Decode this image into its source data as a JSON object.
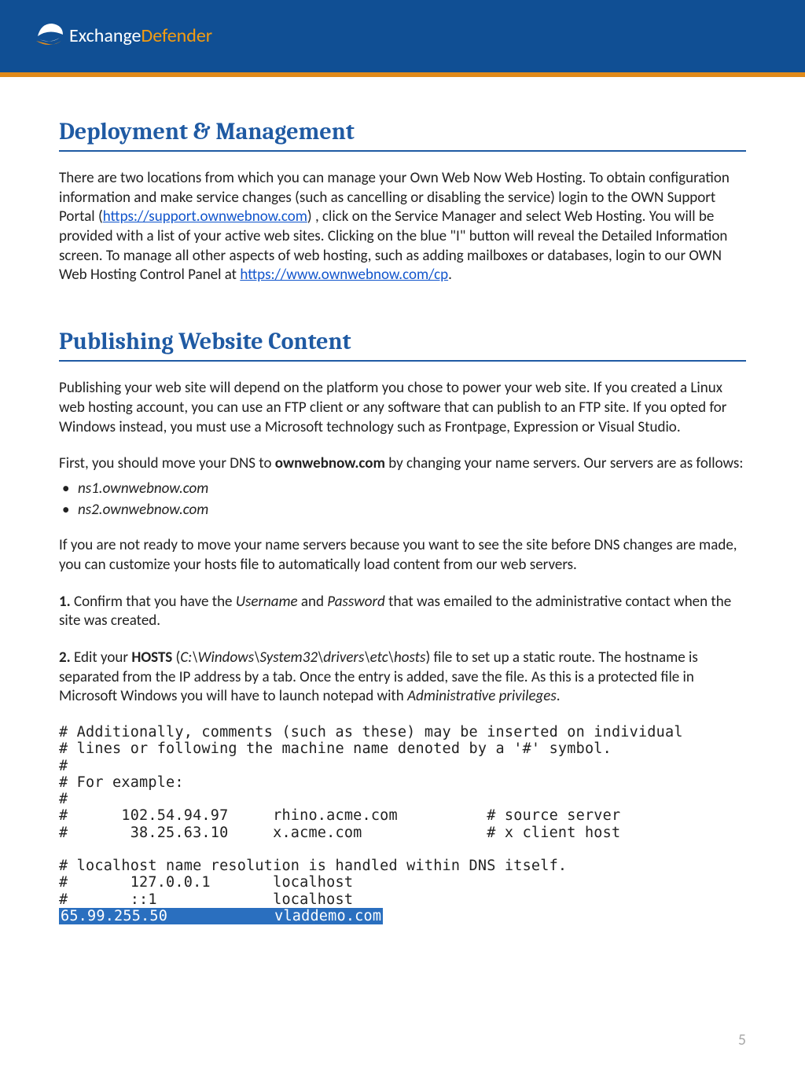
{
  "logo": {
    "part1": "Exchange",
    "part2": "Defender"
  },
  "h1a": "Deployment & Management",
  "p1a": "There are two locations from which you can manage your Own Web Now Web Hosting. To obtain configuration information and make service changes (such as cancelling or disabling the service) login to the OWN Support Portal (",
  "p1link": "https://support.ownwebnow.com",
  "p1b": ") , click on the Service Manager and select Web Hosting. You will be provided with a list of your active web sites. Clicking on the blue \"I\" button will reveal the Detailed Information screen. To manage all other aspects of web hosting, such as adding mailboxes or databases, login to our OWN Web Hosting Control Panel at ",
  "p1link2": "https://www.ownwebnow.com/cp",
  "p1c": ".",
  "h1b": "Publishing Website Content",
  "p2": "Publishing your web site will depend on the platform you chose to power your web site. If you created a Linux web hosting account, you can use an FTP client or any software that can publish to an FTP site. If you opted for Windows instead, you must use a Microsoft technology such as Frontpage, Expression or Visual Studio.",
  "p3a": "First, you should move your DNS to ",
  "p3bold": "ownwebnow.com",
  "p3b": " by changing your name servers. Our servers are as follows:",
  "ns1": "ns1.ownwebnow.com",
  "ns2": "ns2.ownwebnow.com",
  "p4": "If you are not ready to move your name servers because you want to see the site before DNS changes are made, you can customize your hosts file to automatically load content from our web servers.",
  "s1num": "1.",
  "s1a": " Confirm that you have the ",
  "s1i1": "Username",
  "s1b": " and ",
  "s1i2": "Password",
  "s1c": " that was emailed to the administrative contact when the site was created.",
  "s2num": "2.",
  "s2a": " Edit your ",
  "s2bold": "HOSTS",
  "s2b": " (",
  "s2path": "C:\\Windows\\System32\\drivers\\etc\\hosts",
  "s2c": ") file to set up a static route. The hostname is separated from the IP address by a tab. Once the entry is added, save the file. As this is a protected file in Microsoft Windows you will have to launch notepad with ",
  "s2i": "Administrative privileges",
  "s2d": ".",
  "code1": "# Additionally, comments (such as these) may be inserted on individual\n# lines or following the machine name denoted by a '#' symbol.\n#\n# For example:\n#\n#      102.54.94.97     rhino.acme.com          # source server\n#       38.25.63.10     x.acme.com              # x client host\n\n# localhost name resolution is handled within DNS itself.\n#       127.0.0.1       localhost\n#       ::1             localhost",
  "codeHi": "65.99.255.50            vladdemo.com",
  "page": "5"
}
